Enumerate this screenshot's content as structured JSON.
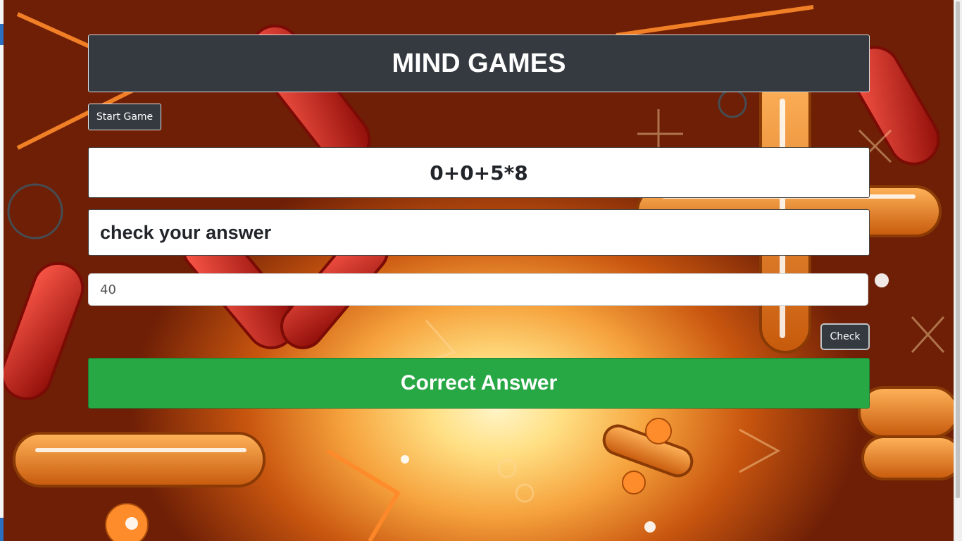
{
  "header": {
    "title": "MIND GAMES"
  },
  "controls": {
    "start_label": "Start Game",
    "check_label": "Check"
  },
  "question": {
    "expression": "0+0+5*8"
  },
  "prompt": {
    "text": "check your answer"
  },
  "answer": {
    "value": "40"
  },
  "result": {
    "text": "Correct Answer",
    "color": "#28a745"
  },
  "colors": {
    "dark": "#343a40",
    "success": "#28a745"
  }
}
